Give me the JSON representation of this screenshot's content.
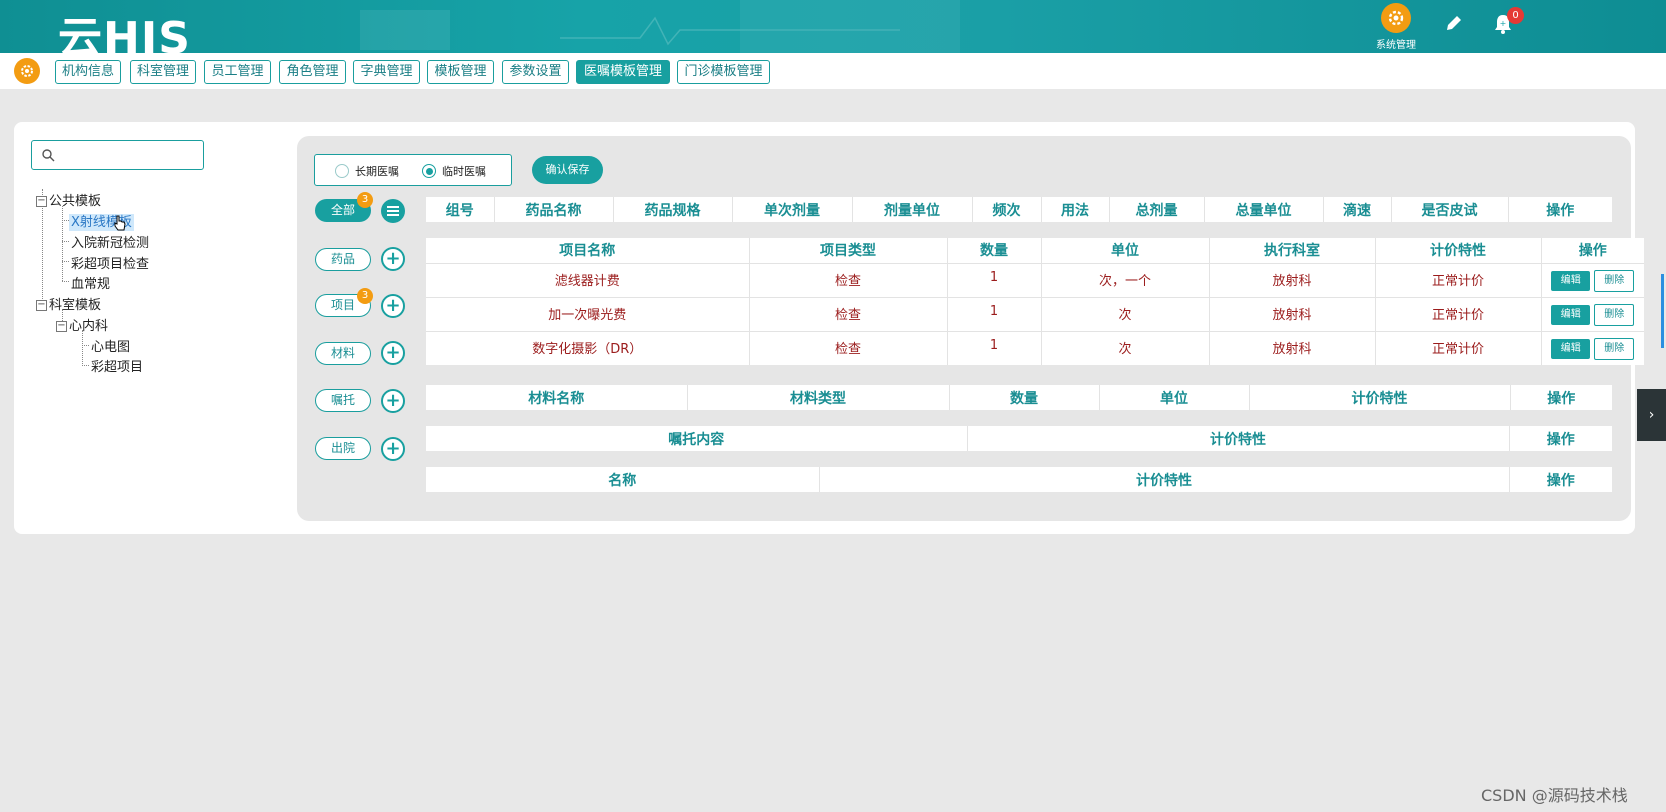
{
  "header": {
    "logo": "云HIS",
    "sys_mgmt_label": "系统管理",
    "notification_count": "0",
    "colors": {
      "header_bg": "#17a3a8",
      "accent": "#18a0a0",
      "badge": "#f39c12",
      "alert": "#e53935"
    }
  },
  "nav": {
    "tabs": [
      {
        "label": "机构信息",
        "active": false
      },
      {
        "label": "科室管理",
        "active": false
      },
      {
        "label": "员工管理",
        "active": false
      },
      {
        "label": "角色管理",
        "active": false
      },
      {
        "label": "字典管理",
        "active": false
      },
      {
        "label": "模板管理",
        "active": false
      },
      {
        "label": "参数设置",
        "active": false
      },
      {
        "label": "医嘱模板管理",
        "active": true
      },
      {
        "label": "门诊模板管理",
        "active": false
      }
    ]
  },
  "sidebar": {
    "search_placeholder": "",
    "tree": {
      "public": {
        "label": "公共模板",
        "children": [
          "X射线模板",
          "入院新冠检测",
          "彩超项目检查",
          "血常规"
        ],
        "selected": "X射线模板"
      },
      "dept": {
        "label": "科室模板",
        "sub": {
          "label": "心内科",
          "children": [
            "心电图",
            "彩超项目"
          ]
        }
      }
    }
  },
  "controls": {
    "radio_long": "长期医嘱",
    "radio_temp": "临时医嘱",
    "radio_selected": "临时医嘱",
    "save_label": "确认保存"
  },
  "categories": {
    "all": {
      "label": "全部",
      "badge": "3"
    },
    "drug": {
      "label": "药品"
    },
    "item": {
      "label": "项目",
      "badge": "3"
    },
    "material": {
      "label": "材料"
    },
    "entrust": {
      "label": "嘱托"
    },
    "discharge": {
      "label": "出院"
    }
  },
  "drug_table": {
    "headers": [
      "组号",
      "药品名称",
      "药品规格",
      "单次剂量",
      "剂量单位",
      "频次",
      "用法",
      "总剂量",
      "总量单位",
      "滴速",
      "是否皮试",
      "操作"
    ]
  },
  "item_table": {
    "headers": [
      "项目名称",
      "项目类型",
      "数量",
      "单位",
      "执行科室",
      "计价特性",
      "操作"
    ],
    "rows": [
      {
        "name": "滤线器计费",
        "type": "检查",
        "qty": "1",
        "unit": "次，一个",
        "dept": "放射科",
        "pricing": "正常计价"
      },
      {
        "name": "加一次曝光费",
        "type": "检查",
        "qty": "1",
        "unit": "次",
        "dept": "放射科",
        "pricing": "正常计价"
      },
      {
        "name": "数字化摄影（DR）",
        "type": "检查",
        "qty": "1",
        "unit": "次",
        "dept": "放射科",
        "pricing": "正常计价"
      }
    ],
    "edit_label": "编辑",
    "delete_label": "删除"
  },
  "material_table": {
    "headers": [
      "材料名称",
      "材料类型",
      "数量",
      "单位",
      "计价特性",
      "操作"
    ]
  },
  "entrust_table": {
    "headers": [
      "嘱托内容",
      "计价特性",
      "操作"
    ]
  },
  "discharge_table": {
    "headers": [
      "名称",
      "计价特性",
      "操作"
    ]
  },
  "watermark": "CSDN @源码技术栈"
}
